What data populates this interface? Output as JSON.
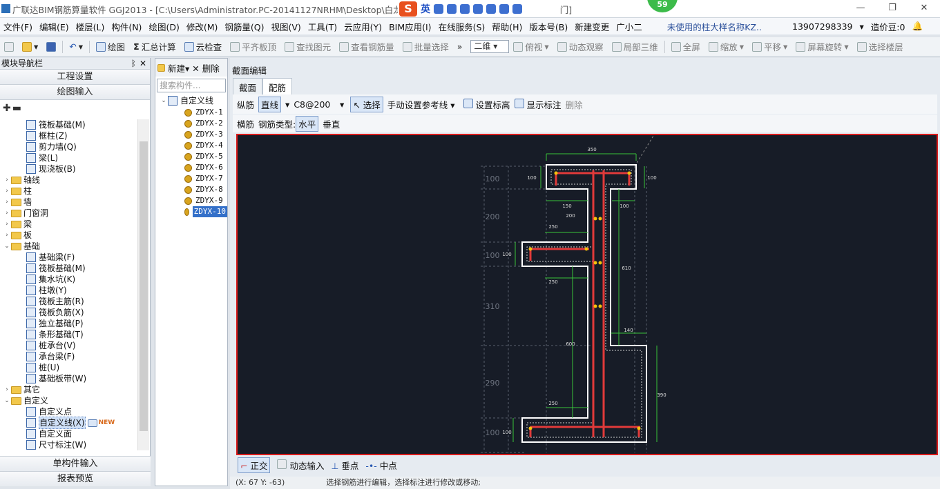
{
  "window": {
    "title": "广联达BIM钢筋算量软件 GGJ2013 - [C:\\Users\\Administrator.PC-20141127NRHM\\Desktop\\白龙村-",
    "title_tail": "门]",
    "badge": "59",
    "ime": "英",
    "minimize": "—",
    "restore": "❐",
    "close": "✕"
  },
  "menu": [
    "文件(F)",
    "编辑(E)",
    "楼层(L)",
    "构件(N)",
    "绘图(D)",
    "修改(M)",
    "钢筋量(Q)",
    "视图(V)",
    "工具(T)",
    "云应用(Y)",
    "BIM应用(I)",
    "在线服务(S)",
    "帮助(H)",
    "版本号(B)",
    "新建变更",
    "广小二"
  ],
  "menu_right": {
    "unused": "未使用的柱大样名称KZ..",
    "phone": "13907298339",
    "beans": "造价豆:0"
  },
  "toolbar": {
    "draw": "绘图",
    "sum": "汇总计算",
    "cloud": "云检查",
    "flat": "平齐板顶",
    "find": "查找图元",
    "view_rebar": "查看钢筋量",
    "batch": "批量选择",
    "dim": "二维",
    "top": "俯视",
    "dynamic": "动态观察",
    "local3d": "局部三维",
    "fullscreen": "全屏",
    "zoom": "缩放",
    "pan": "平移",
    "rotate": "屏幕旋转",
    "select_floor": "选择楼层",
    "chev": "»"
  },
  "nav": {
    "title": "模块导航栏",
    "pin": "ᛒ",
    "close": "✕",
    "project": "工程设置",
    "draw_input": "绘图输入",
    "single_input": "单构件输入",
    "report": "报表预览",
    "items": [
      {
        "label": "筏板基础(M)",
        "level": 2,
        "type": "icon"
      },
      {
        "label": "框柱(Z)",
        "level": 2,
        "type": "icon"
      },
      {
        "label": "剪力墙(Q)",
        "level": 2,
        "type": "icon"
      },
      {
        "label": "梁(L)",
        "level": 2,
        "type": "icon"
      },
      {
        "label": "现浇板(B)",
        "level": 2,
        "type": "icon"
      },
      {
        "label": "轴线",
        "level": 1,
        "type": "folder",
        "exp": "›"
      },
      {
        "label": "柱",
        "level": 1,
        "type": "folder",
        "exp": "›"
      },
      {
        "label": "墙",
        "level": 1,
        "type": "folder",
        "exp": "›"
      },
      {
        "label": "门窗洞",
        "level": 1,
        "type": "folder",
        "exp": "›"
      },
      {
        "label": "梁",
        "level": 1,
        "type": "folder",
        "exp": "›"
      },
      {
        "label": "板",
        "level": 1,
        "type": "folder",
        "exp": "›"
      },
      {
        "label": "基础",
        "level": 1,
        "type": "folder",
        "exp": "⌄"
      },
      {
        "label": "基础梁(F)",
        "level": 2,
        "type": "icon"
      },
      {
        "label": "筏板基础(M)",
        "level": 2,
        "type": "icon"
      },
      {
        "label": "集水坑(K)",
        "level": 2,
        "type": "icon"
      },
      {
        "label": "柱墩(Y)",
        "level": 2,
        "type": "icon"
      },
      {
        "label": "筏板主筋(R)",
        "level": 2,
        "type": "icon"
      },
      {
        "label": "筏板负筋(X)",
        "level": 2,
        "type": "icon"
      },
      {
        "label": "独立基础(P)",
        "level": 2,
        "type": "icon"
      },
      {
        "label": "条形基础(T)",
        "level": 2,
        "type": "icon"
      },
      {
        "label": "桩承台(V)",
        "level": 2,
        "type": "icon"
      },
      {
        "label": "承台梁(F)",
        "level": 2,
        "type": "icon"
      },
      {
        "label": "桩(U)",
        "level": 2,
        "type": "icon"
      },
      {
        "label": "基础板带(W)",
        "level": 2,
        "type": "icon"
      },
      {
        "label": "其它",
        "level": 1,
        "type": "folder",
        "exp": "›"
      },
      {
        "label": "自定义",
        "level": 1,
        "type": "folder",
        "exp": "⌄"
      },
      {
        "label": "自定义点",
        "level": 2,
        "type": "icon"
      },
      {
        "label": "自定义线(X)",
        "level": 2,
        "type": "icon",
        "new": "NEW",
        "selected": true
      },
      {
        "label": "自定义面",
        "level": 2,
        "type": "icon"
      },
      {
        "label": "尺寸标注(W)",
        "level": 2,
        "type": "icon"
      }
    ]
  },
  "components": {
    "new": "新建",
    "delete": "删除",
    "search_placeholder": "搜索构件...",
    "root": "自定义线",
    "root_exp": "⌄",
    "items": [
      "ZDYX-1",
      "ZDYX-2",
      "ZDYX-3",
      "ZDYX-4",
      "ZDYX-5",
      "ZDYX-6",
      "ZDYX-7",
      "ZDYX-8",
      "ZDYX-9",
      "ZDYX-10"
    ],
    "selected_index": 9
  },
  "section": {
    "title": "截面编辑",
    "tabs": [
      "截面",
      "配筋"
    ],
    "active_tab": 1,
    "row1": {
      "longitudinal": "纵筋",
      "line": "直线",
      "spec": "C8@200",
      "select": "选择",
      "manual_ref": "手动设置参考线",
      "set_elev": "设置标高",
      "show_dim": "显示标注",
      "delete": "删除"
    },
    "row2": {
      "transverse": "横筋",
      "rebar_type": "钢筋类型:",
      "horizontal": "水平",
      "vertical": "垂直"
    }
  },
  "bottom": {
    "ortho": "正交",
    "dynamic_input": "动态输入",
    "perp": "垂点",
    "mid": "中点"
  },
  "status": {
    "coords": "(X: 67 Y: -63)",
    "message": "选择钢筋进行编辑，选择标注进行修改或移动;"
  },
  "drawing": {
    "dims": [
      "350",
      "100",
      "100",
      "150",
      "200",
      "100",
      "250",
      "100",
      "610",
      "250",
      "140",
      "600",
      "390",
      "250",
      "100"
    ],
    "axis": [
      "100",
      "200",
      "100",
      "310",
      "290",
      "100"
    ]
  },
  "colors": {
    "canvas_bg": "#171c27",
    "outline": "#ffffff",
    "rebar": "#e23a3a",
    "dim": "#38c43a",
    "accent": "#d91c1c"
  }
}
